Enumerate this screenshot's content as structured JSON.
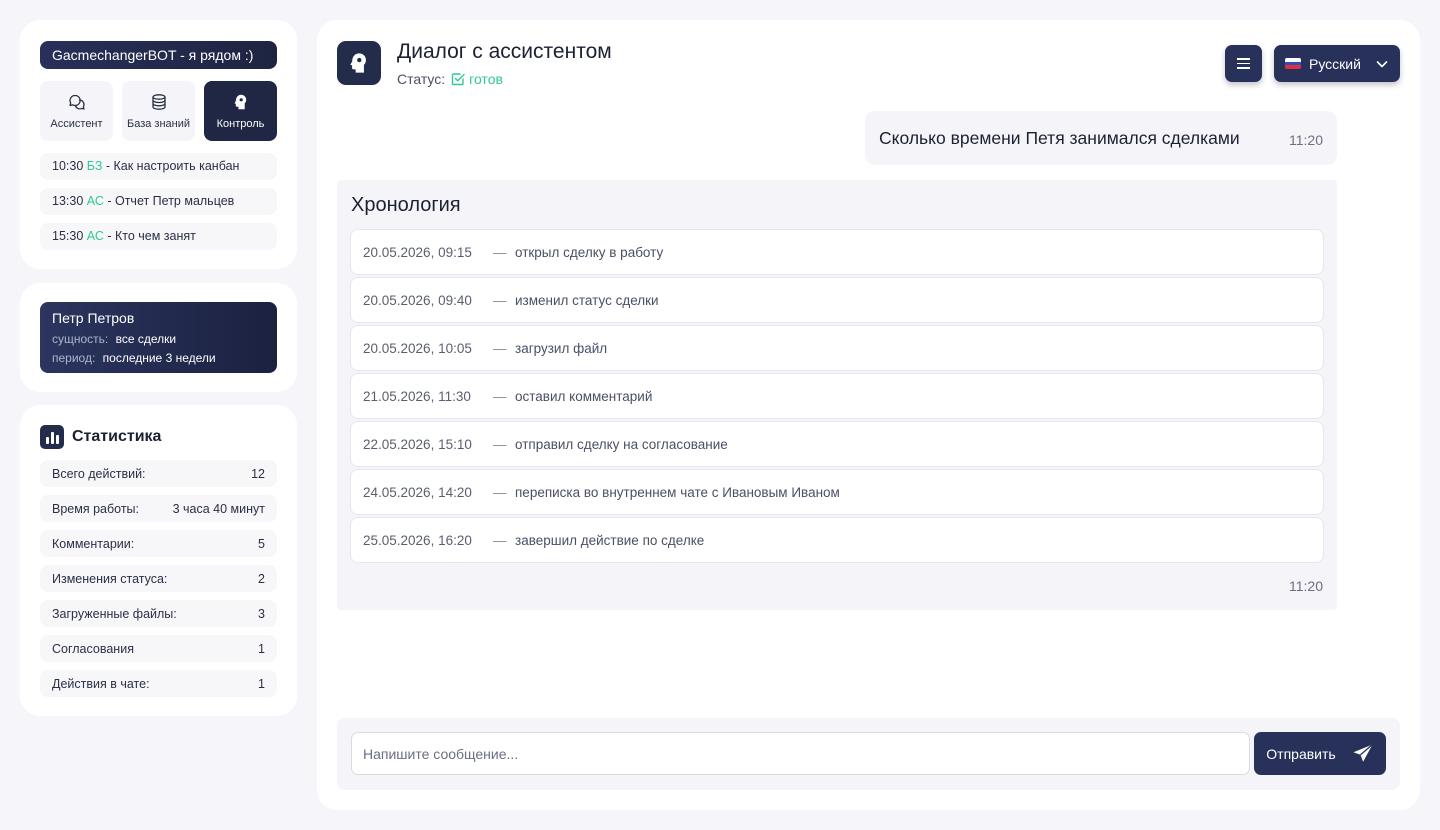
{
  "sidebar": {
    "bot_banner": "GacmechangerBOT - я рядом :)",
    "modes": [
      {
        "label": "Ассистент",
        "icon": "chat-bubbles-icon",
        "active": false
      },
      {
        "label": "База знаний",
        "icon": "database-icon",
        "active": false
      },
      {
        "label": "Контроль",
        "icon": "head-icon",
        "active": true
      }
    ],
    "history": [
      {
        "time": "10:30",
        "tag": "БЗ",
        "text": "- Как настроить канбан"
      },
      {
        "time": "13:30",
        "tag": "АС",
        "text": "- Отчет Петр мальцев"
      },
      {
        "time": "15:30",
        "tag": "АС",
        "text": "- Кто чем занят"
      }
    ],
    "accent_color": "#2fc996"
  },
  "profile": {
    "name": "Петр Петров",
    "entity_label": "сущность:",
    "entity_value": "все сделки",
    "period_label": "период:",
    "period_value": "последние 3 недели"
  },
  "stats": {
    "title": "Статистика",
    "rows": [
      {
        "label": "Всего действий:",
        "value": "12"
      },
      {
        "label": "Время работы:",
        "value": "3 часа 40 минут"
      },
      {
        "label": "Комментарии:",
        "value": "5"
      },
      {
        "label": "Изменения статуса:",
        "value": "2"
      },
      {
        "label": "Загруженные файлы:",
        "value": "3"
      },
      {
        "label": "Согласования",
        "value": "1"
      },
      {
        "label": "Действия в чате:",
        "value": "1"
      }
    ]
  },
  "chat": {
    "title": "Диалог с ассистентом",
    "status_label": "Статус:",
    "status_value": "готов",
    "language": "Русский",
    "user_message": {
      "text": "Сколько времени Петя занимался сделками",
      "time": "11:20"
    },
    "bot_message": {
      "title": "Хронология",
      "time": "11:20",
      "events": [
        {
          "date": "20.05.2026, 09:15",
          "dash": "—",
          "text": "открыл сделку в работу"
        },
        {
          "date": "20.05.2026, 09:40",
          "dash": "—",
          "text": "изменил статус сделки"
        },
        {
          "date": "20.05.2026, 10:05",
          "dash": "—",
          "text": "загрузил файл"
        },
        {
          "date": "21.05.2026, 11:30",
          "dash": "—",
          "text": "оставил комментарий"
        },
        {
          "date": "22.05.2026, 15:10",
          "dash": "—",
          "text": "отправил сделку на согласование"
        },
        {
          "date": "24.05.2026, 14:20",
          "dash": "—",
          "text": "переписка во внутреннем чате с Ивановым Иваном"
        },
        {
          "date": "25.05.2026, 16:20",
          "dash": "—",
          "text": "завершил действие по сделке"
        }
      ]
    },
    "composer": {
      "placeholder": "Напишите сообщение...",
      "send_label": "Отправить"
    }
  }
}
